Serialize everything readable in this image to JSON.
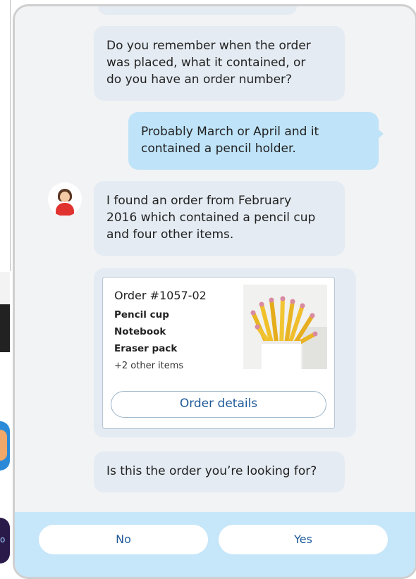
{
  "conversation": {
    "bot_question_1": [
      "Do you remember when the order",
      "was placed, what it contained, or",
      "do you have an order number?"
    ],
    "user_reply": [
      "Probably March or April and it",
      "contained a pencil holder."
    ],
    "bot_found": [
      "I found an order from February",
      "2016 which contained a pencil cup",
      "and four other items."
    ],
    "bot_question_2": "Is this the order you’re looking for?"
  },
  "order_card": {
    "title": "Order #1057-02",
    "items": [
      "Pencil cup",
      "Notebook",
      "Eraser pack"
    ],
    "more": "+2 other items",
    "details_button": "Order details",
    "image": "pencil-cup-image"
  },
  "quick_replies": {
    "no": "No",
    "yes": "Yes"
  },
  "colors": {
    "bot_bubble": "#e4ebf2",
    "user_bubble": "#bfe3f8",
    "accent_text": "#1f5a99",
    "reply_bar": "#c6e6fa"
  },
  "icons": [
    "bot-avatar-icon"
  ]
}
